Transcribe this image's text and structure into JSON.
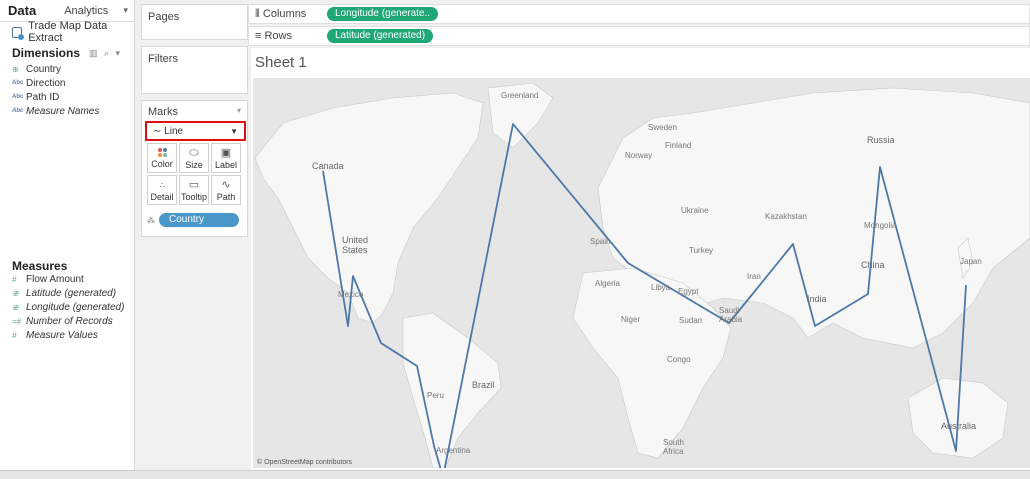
{
  "data_pane": {
    "tab_data": "Data",
    "tab_analytics": "Analytics",
    "datasource": "Trade Map Data Extract",
    "dimensions_title": "Dimensions",
    "dimensions": [
      {
        "label": "Country",
        "type": "globe"
      },
      {
        "label": "Direction",
        "type": "abc"
      },
      {
        "label": "Path ID",
        "type": "abc"
      },
      {
        "label": "Measure Names",
        "type": "abc"
      }
    ],
    "measures_title": "Measures",
    "measures": [
      {
        "label": "Flow Amount",
        "type": "hash"
      },
      {
        "label": "Latitude (generated)",
        "type": "globe"
      },
      {
        "label": "Longitude (generated)",
        "type": "globe"
      },
      {
        "label": "Number of Records",
        "type": "hash"
      },
      {
        "label": "Measure Values",
        "type": "hash"
      }
    ]
  },
  "shelves": {
    "pages": "Pages",
    "filters": "Filters",
    "columns_label": "Columns",
    "columns_pill": "Longitude (generate..",
    "rows_label": "Rows",
    "rows_pill": "Latitude (generated)"
  },
  "marks": {
    "title": "Marks",
    "mark_type": "Line",
    "buttons": [
      {
        "label": "Color",
        "icon": "color-dots-icon"
      },
      {
        "label": "Size",
        "icon": "size-icon"
      },
      {
        "label": "Label",
        "icon": "label-icon"
      },
      {
        "label": "Detail",
        "icon": "detail-icon"
      },
      {
        "label": "Tooltip",
        "icon": "tooltip-icon"
      },
      {
        "label": "Path",
        "icon": "path-icon"
      }
    ],
    "path_field": "Country"
  },
  "sheet": {
    "title": "Sheet 1",
    "attribution": "© OpenStreetMap contributors"
  },
  "map_labels": {
    "canada": "Canada",
    "united_states": "United States",
    "mexico": "Mexico",
    "brazil": "Brazil",
    "argentina": "Argentina",
    "russia": "Russia",
    "china": "China",
    "india": "India",
    "australia": "Australia",
    "greenland": "Greenland",
    "kazakhstan": "Kazakhstan",
    "japan": "Japan",
    "egypt": "Egypt",
    "libya": "Libya",
    "algeria": "Algeria",
    "saudi_arabia": "Saudi Arabia",
    "iran": "Iran",
    "turkey": "Turkey",
    "ukraine": "Ukraine",
    "sweden": "Sweden",
    "finland": "Finland",
    "norway": "Norway",
    "spain": "Spain",
    "sudan": "Sudan",
    "mongolia": "Mongolia",
    "niger": "Niger",
    "congo": "Congo",
    "south_africa": "South Africa",
    "peru": "Peru"
  },
  "colors": {
    "path_line": "#4d79a9",
    "map_land": "#f7f7f7",
    "map_water": "#e6e6e6",
    "pill_green": "#1fa776",
    "pill_blue": "#4a98c9",
    "highlight_red": "#e01010"
  }
}
